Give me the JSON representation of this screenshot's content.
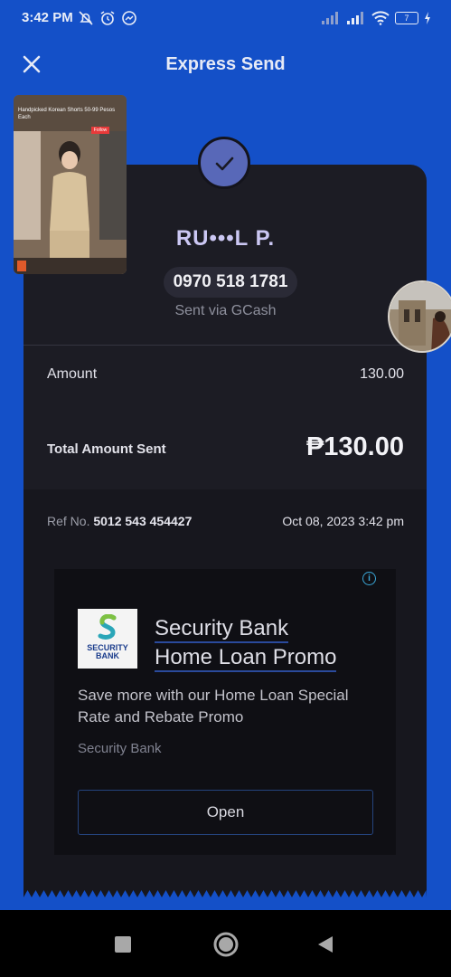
{
  "status_bar": {
    "time": "3:42 PM",
    "battery": "7"
  },
  "header": {
    "title": "Express Send",
    "close_icon": "close-icon"
  },
  "receipt": {
    "recipient_name": "RU•••L P.",
    "phone": "0970 518 1781",
    "sent_via": "Sent via GCash",
    "amount_label": "Amount",
    "amount_value": "130.00",
    "total_label": "Total Amount Sent",
    "total_value": "₱130.00",
    "ref_label": "Ref No.",
    "ref_number": "5012 543 454427",
    "date": "Oct 08, 2023 3:42 pm"
  },
  "ad": {
    "logo_text_line1": "SECURITY",
    "logo_text_line2": "BANK",
    "headline_line1": "Security Bank",
    "headline_line2": "Home Loan Promo",
    "description": "Save more with our Home Loan Special Rate and Rebate Promo",
    "brand": "Security Bank",
    "cta": "Open",
    "info_glyph": "i"
  },
  "floating_video": {
    "title": "Handpicked Korean Shorts 50-99 Pesos Each",
    "badge": "Follow"
  },
  "colors": {
    "background": "#1450c8",
    "card": "#1c1c24",
    "check_circle": "#5868b8",
    "recipient_name": "#cbc7f3",
    "ad_link_underline": "#2a4a9c"
  }
}
